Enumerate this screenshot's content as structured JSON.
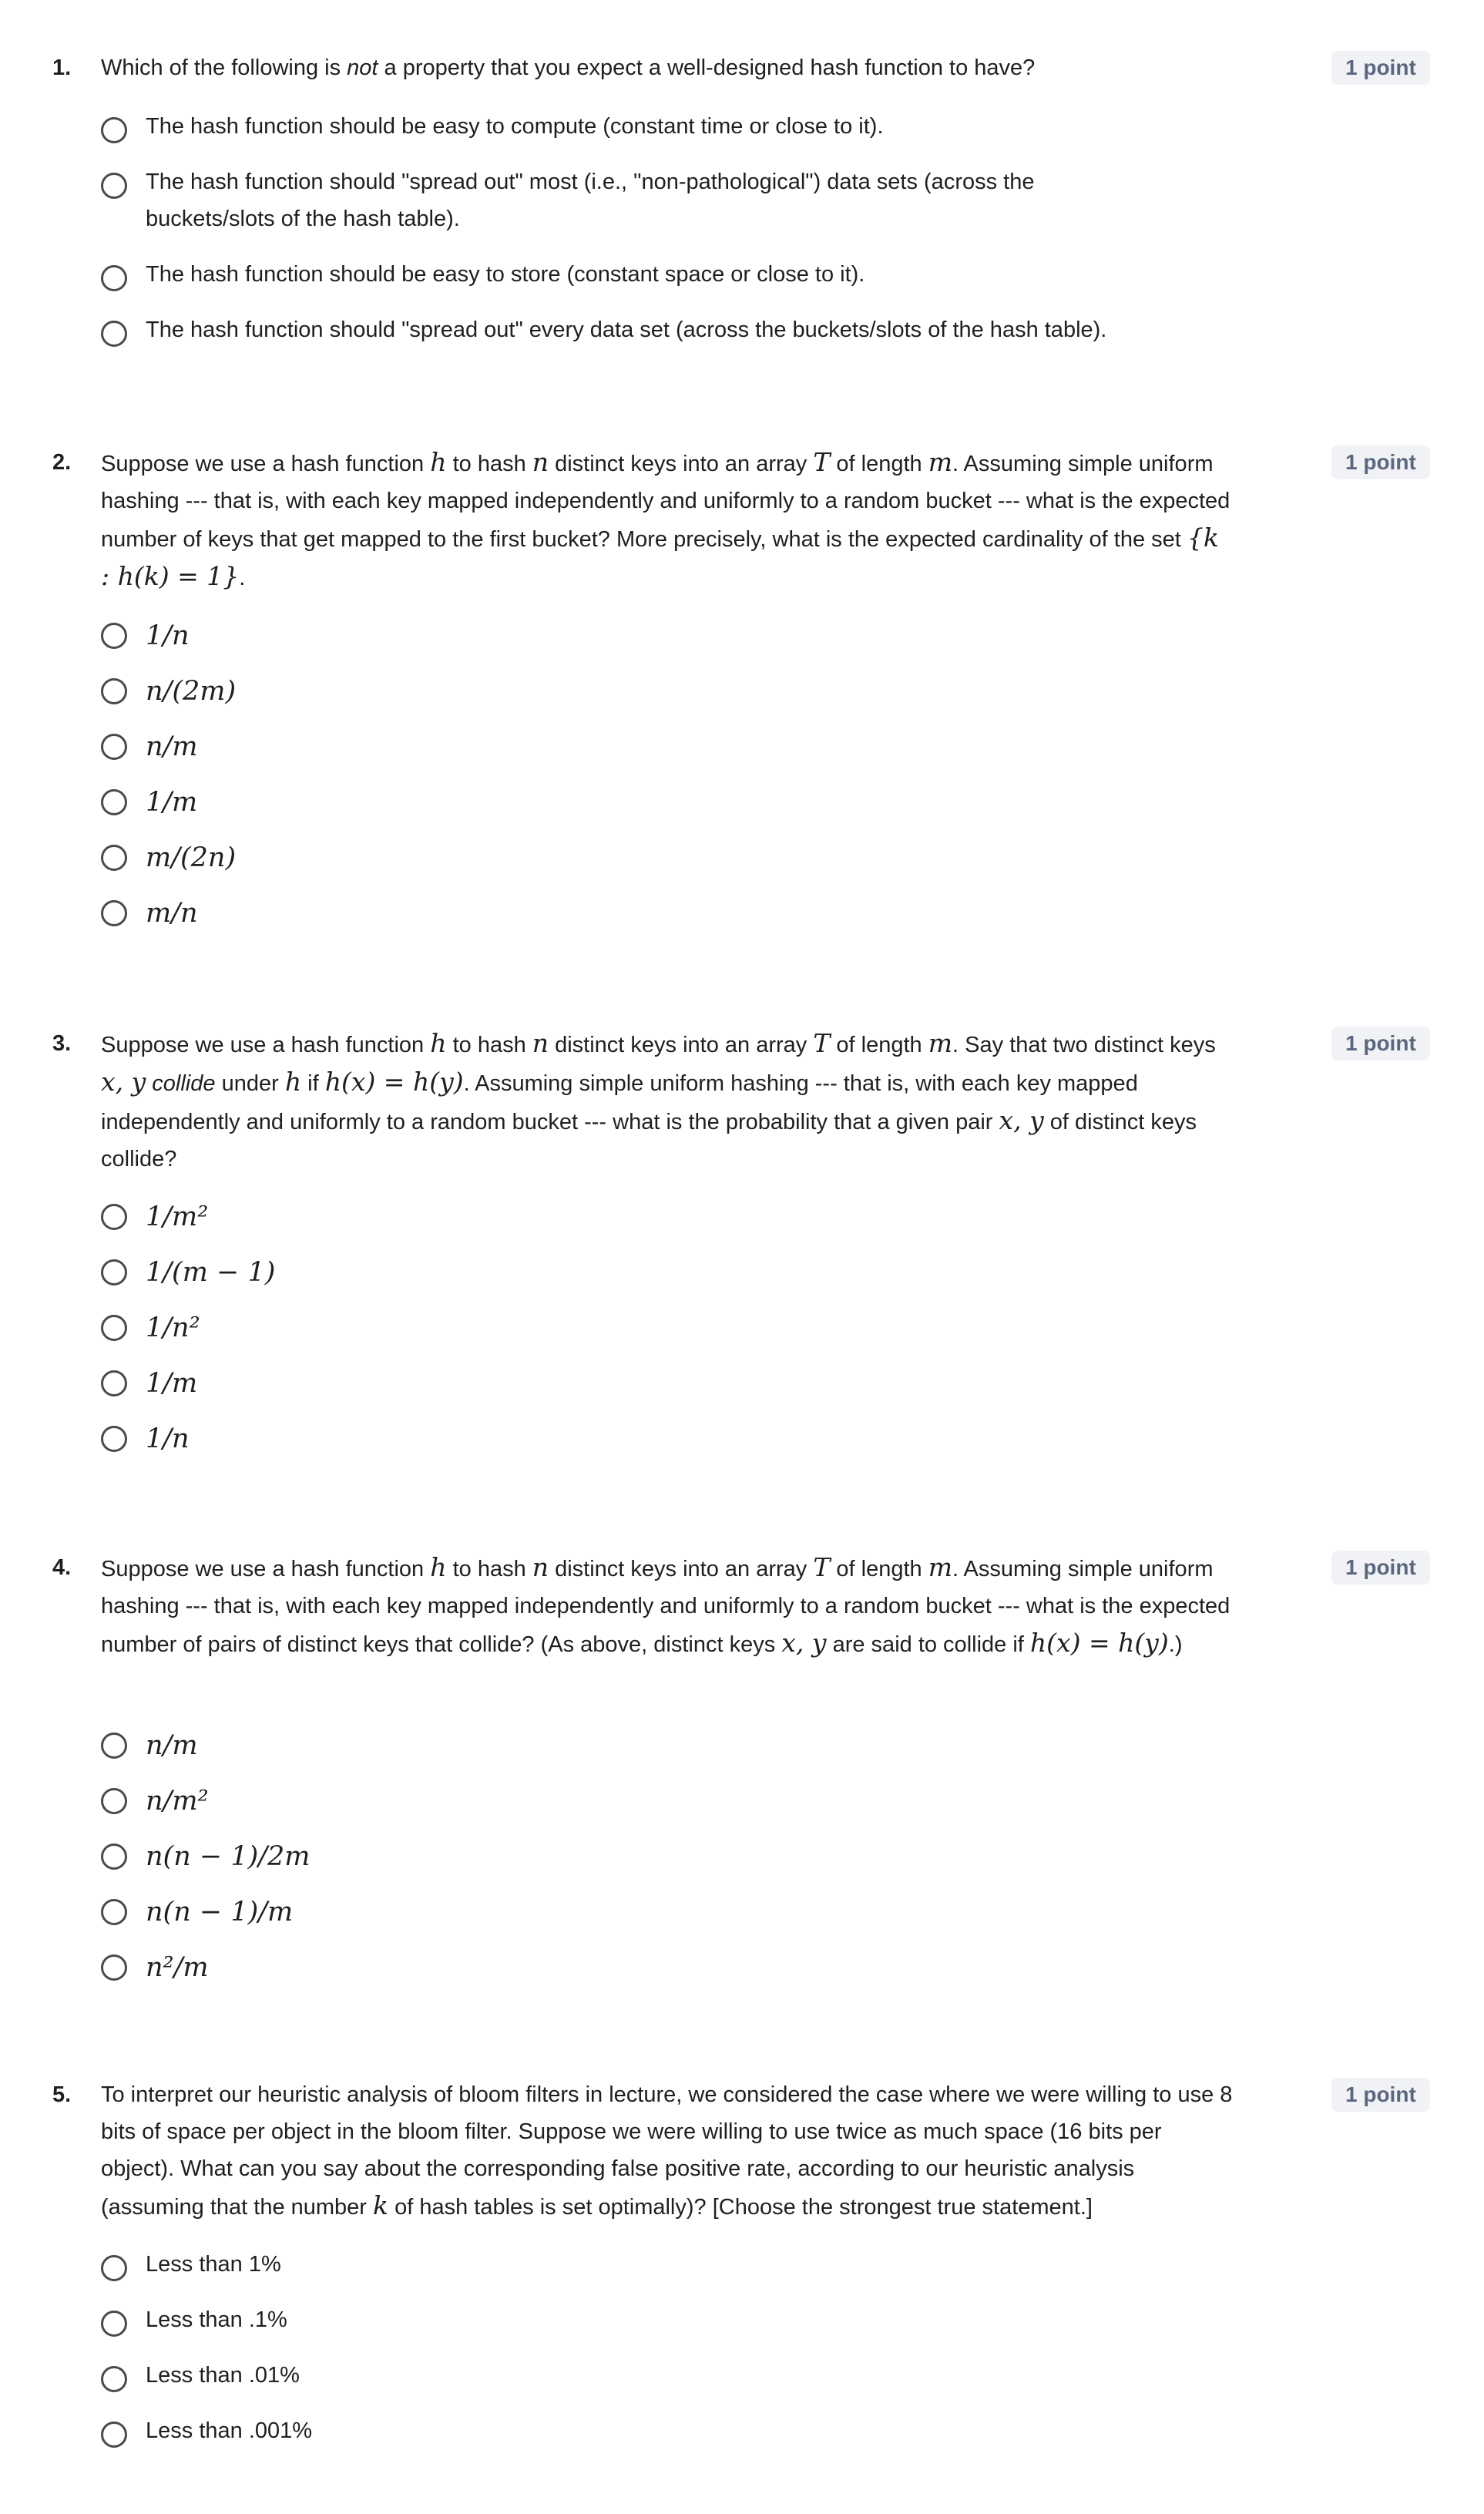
{
  "questions": [
    {
      "number": "1.",
      "points": "1 point",
      "text_parts": [
        "Which of the following is ",
        "not",
        " a property that you expect a well-designed hash function to have?"
      ],
      "options": [
        "The hash function should be easy to compute (constant time or close to it).",
        "The hash function should \"spread out\" most (i.e., \"non-pathological\") data sets (across the buckets/slots of the hash table).",
        "The hash function should be easy to store (constant space or close to it).",
        "The hash function should \"spread out\" every data set (across the buckets/slots of the hash table)."
      ]
    },
    {
      "number": "2.",
      "points": "1 point",
      "text_parts": [
        "Suppose we use a hash function ",
        "h",
        " to hash ",
        "n",
        " distinct keys into an array ",
        "T",
        " of length ",
        "m",
        ". Assuming simple uniform hashing --- that is, with each key mapped independently and uniformly to a random bucket --- what is the expected number of keys that get mapped to the first bucket? More precisely, what is the expected cardinality of the set ",
        "{k : h(k) = 1}",
        "."
      ],
      "options": [
        "1/n",
        "n/(2m)",
        "n/m",
        "1/m",
        "m/(2n)",
        "m/n"
      ]
    },
    {
      "number": "3.",
      "points": "1 point",
      "text_parts": [
        "Suppose we use a hash function ",
        "h",
        " to hash ",
        "n",
        " distinct keys into an array ",
        "T",
        " of length ",
        "m",
        ". Say that two distinct keys ",
        "x, y",
        " ",
        "collide",
        " under ",
        "h",
        " if ",
        "h(x) = h(y)",
        ".  Assuming simple uniform hashing --- that is, with each key mapped independently and uniformly to a random bucket --- what is the probability that a given pair ",
        "x, y",
        " of distinct keys collide?"
      ],
      "options": [
        "1/m²",
        "1/(m − 1)",
        "1/n²",
        "1/m",
        "1/n"
      ]
    },
    {
      "number": "4.",
      "points": "1 point",
      "text_parts": [
        "Suppose we use a hash function ",
        "h",
        " to hash ",
        "n",
        " distinct keys into an array ",
        "T",
        " of length ",
        "m",
        ". Assuming simple uniform hashing --- that is, with each key mapped independently and uniformly to a random bucket --- what is the expected number of pairs of distinct keys that collide?  (As above, distinct keys ",
        "x, y",
        " are said to collide if ",
        "h(x) = h(y)",
        ".)"
      ],
      "options": [
        "n/m",
        "n/m²",
        "n(n − 1)/2m",
        "n(n − 1)/m",
        "n²/m"
      ]
    },
    {
      "number": "5.",
      "points": "1 point",
      "text_parts": [
        "To interpret our heuristic analysis of bloom filters in lecture, we considered the case where we were willing to use 8 bits of space per object in the bloom filter.  Suppose we were willing to use twice as much space (16 bits per object).  What can you say about the corresponding false positive rate, according to our heuristic analysis (assuming that the number ",
        "k",
        " of hash tables is set optimally)?  [Choose the strongest true statement.]"
      ],
      "options": [
        "Less than 1%",
        "Less than .1%",
        "Less than .01%",
        "Less than .001%"
      ]
    }
  ]
}
